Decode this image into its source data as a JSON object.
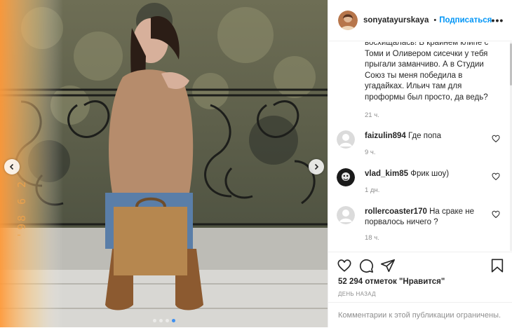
{
  "post": {
    "date_stamp": "'98 6 2",
    "carousel": {
      "count": 4,
      "active_index": 3
    }
  },
  "header": {
    "username": "sonyatayurskaya",
    "separator": "•",
    "follow_label": "Подписаться",
    "more_label": "•••"
  },
  "first_comment": {
    "text": "восхищалась! В крайнем клипе с Томи и Оливером сисечки у тебя прыгали заманчиво. А в Студии Союз ты меня победила в угадайках. Ильич там для проформы был просто, да ведь?",
    "time": "21 ч."
  },
  "comments": [
    {
      "username": "faizulin894",
      "text": "Где попа",
      "time": "9 ч."
    },
    {
      "username": "vlad_kim85",
      "text": "Фрик шоу)",
      "time": "1 дн."
    },
    {
      "username": "rollercoaster170",
      "text": "На сраке не порвалось ничего ?",
      "time": "18 ч."
    }
  ],
  "likes": "52 294 отметок \"Нравится\"",
  "posted_ago": "ДЕНЬ НАЗАД",
  "comments_limited": "Комментарии к этой публикации ограничены.",
  "icons": [
    "chevron-left-icon",
    "chevron-right-icon",
    "verified-badge-icon",
    "more-icon",
    "heart-icon",
    "comment-icon",
    "share-icon",
    "bookmark-icon"
  ],
  "colors": {
    "accent": "#0095f6",
    "text": "#262626",
    "muted": "#8e8e8e",
    "border": "#efefef",
    "dot_active": "#3d8ff0"
  }
}
